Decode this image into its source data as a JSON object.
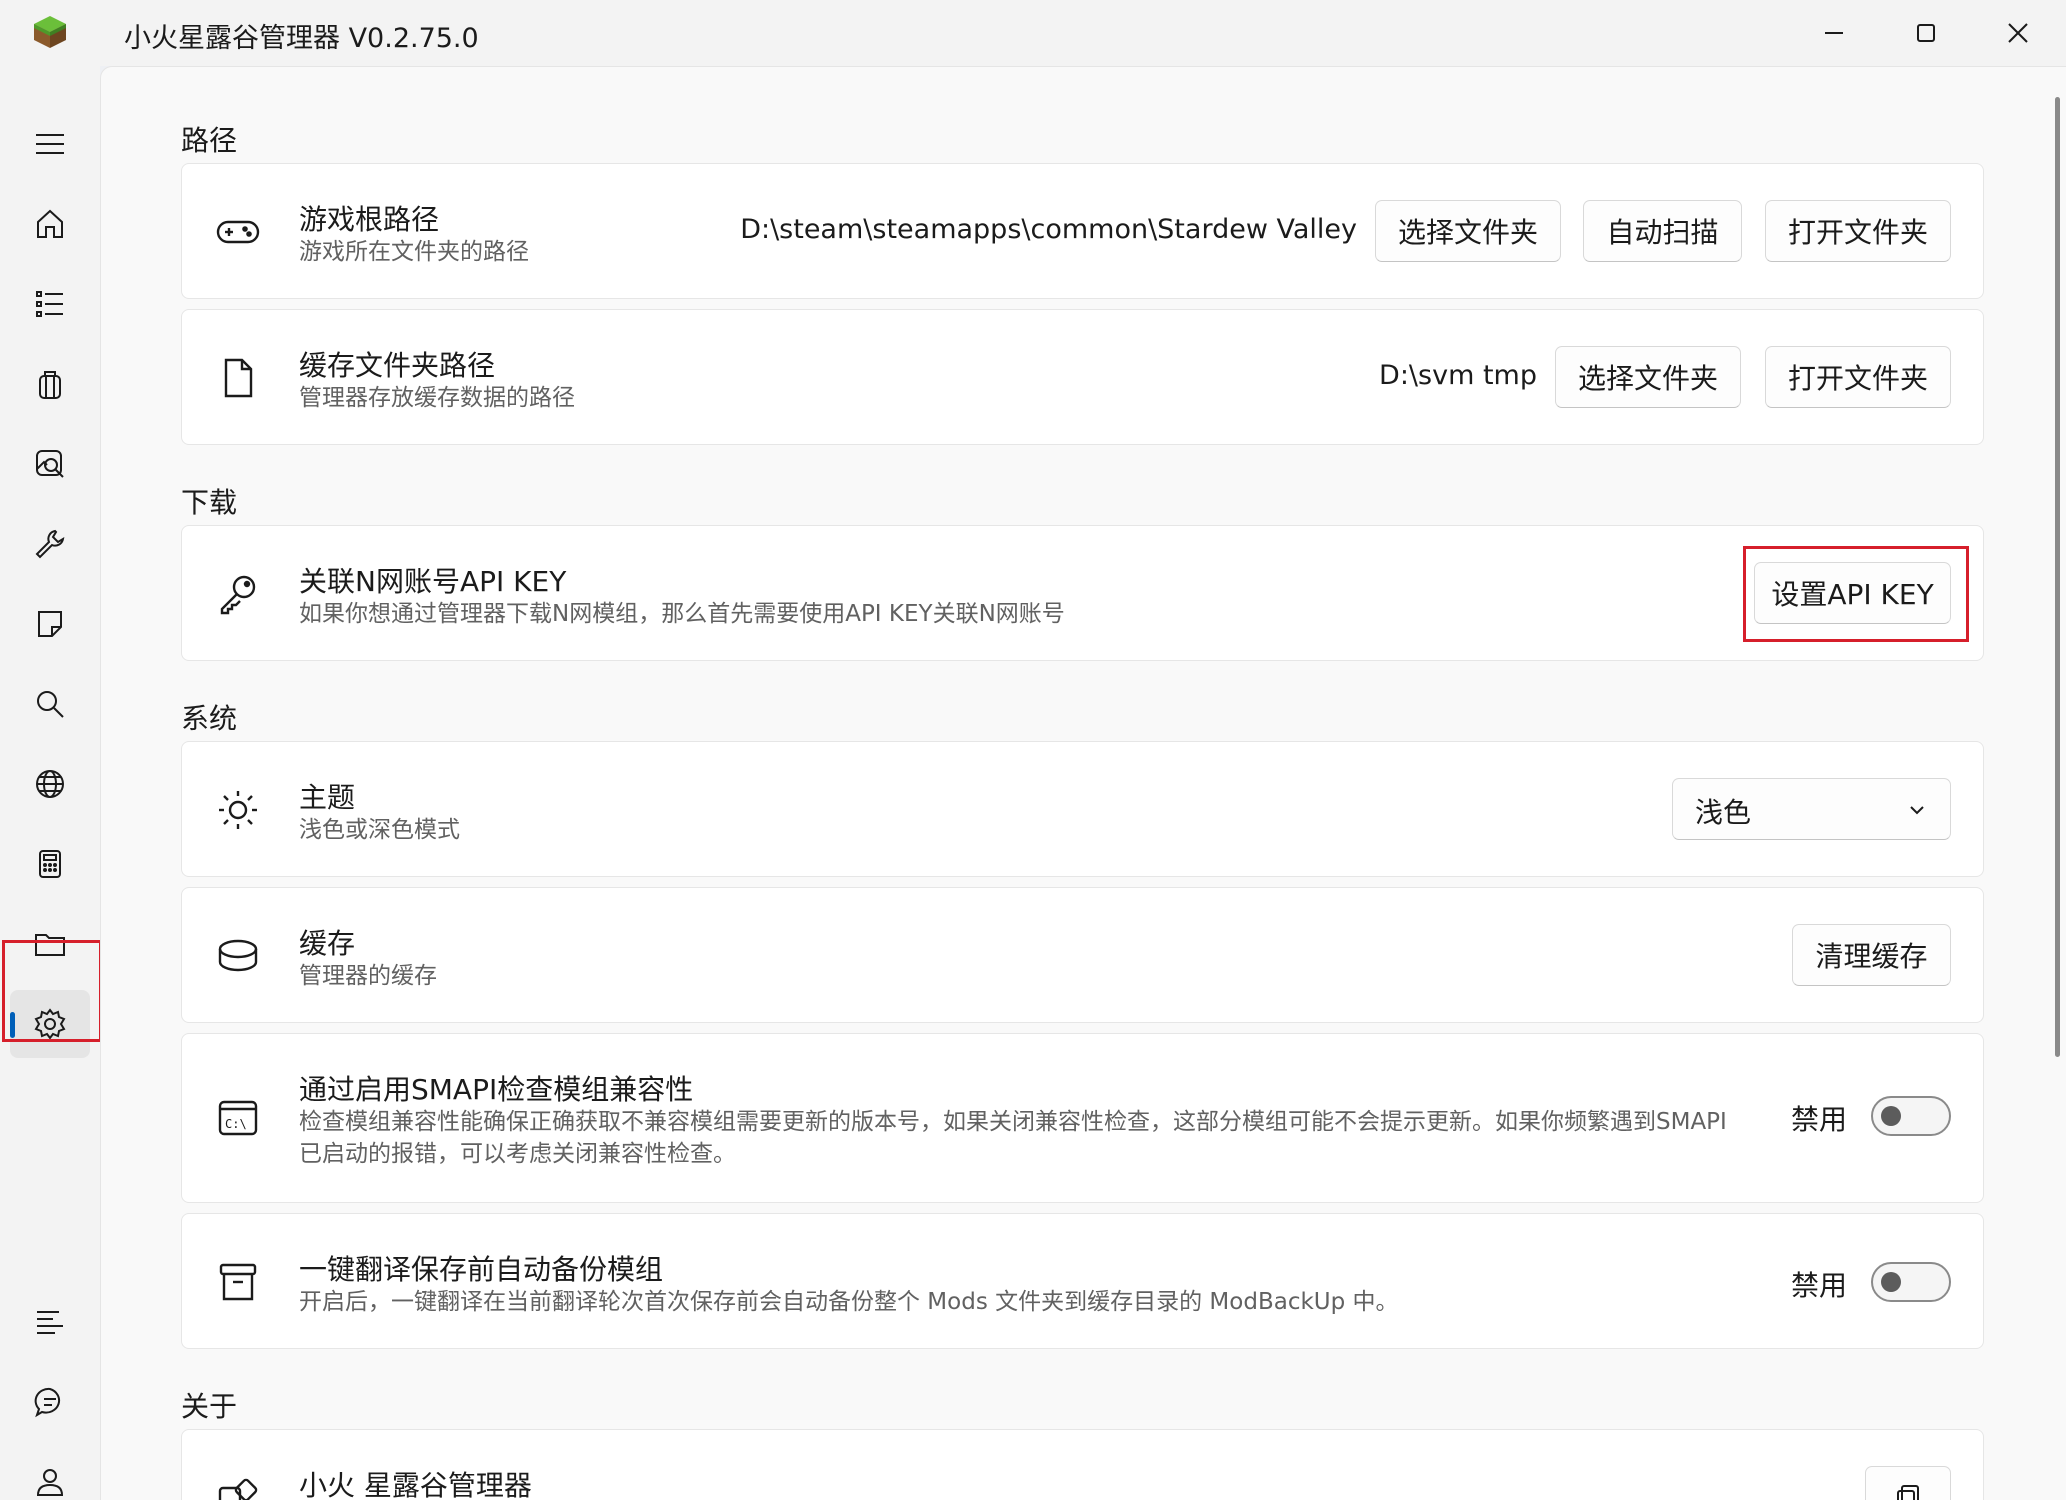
{
  "window": {
    "title": "小火星露谷管理器 V0.2.75.0"
  },
  "sidebar": {
    "items": [
      {
        "icon": "menu-icon"
      },
      {
        "icon": "home-icon"
      },
      {
        "icon": "list-icon"
      },
      {
        "icon": "backpack-icon"
      },
      {
        "icon": "image-search-icon"
      },
      {
        "icon": "wrench-icon"
      },
      {
        "icon": "note-icon"
      },
      {
        "icon": "search-icon"
      },
      {
        "icon": "globe-icon"
      },
      {
        "icon": "calculator-icon"
      },
      {
        "icon": "folder-icon"
      },
      {
        "icon": "gear-icon"
      }
    ],
    "bottom_items": [
      {
        "icon": "log-list-icon"
      },
      {
        "icon": "chat-icon"
      },
      {
        "icon": "user-icon"
      }
    ]
  },
  "sections": {
    "path": {
      "title": "路径",
      "game_root": {
        "title": "游戏根路径",
        "desc": "游戏所在文件夹的路径",
        "value": "D:\\steam\\steamapps\\common\\Stardew Valley",
        "btn_select": "选择文件夹",
        "btn_scan": "自动扫描",
        "btn_open": "打开文件夹"
      },
      "cache_folder": {
        "title": "缓存文件夹路径",
        "desc": "管理器存放缓存数据的路径",
        "value": "D:\\svm tmp",
        "btn_select": "选择文件夹",
        "btn_open": "打开文件夹"
      }
    },
    "download": {
      "title": "下载",
      "api_key": {
        "title": "关联N网账号API KEY",
        "desc": "如果你想通过管理器下载N网模组，那么首先需要使用API KEY关联N网账号",
        "btn": "设置API KEY"
      }
    },
    "system": {
      "title": "系统",
      "theme": {
        "title": "主题",
        "desc": "浅色或深色模式",
        "selected": "浅色"
      },
      "cache": {
        "title": "缓存",
        "desc": "管理器的缓存",
        "btn": "清理缓存"
      },
      "smapi": {
        "title": "通过启用SMAPI检查模组兼容性",
        "desc": "检查模组兼容性能确保正确获取不兼容模组需要更新的版本号，如果关闭兼容性检查，这部分模组可能不会提示更新。如果你频繁遇到SMAPI已启动的报错，可以考虑关闭兼容性检查。",
        "toggle_label": "禁用"
      },
      "backup": {
        "title": "一键翻译保存前自动备份模组",
        "desc": "开启后，一键翻译在当前翻译轮次首次保存前会自动备份整个 Mods 文件夹到缓存目录的 ModBackUp 中。",
        "toggle_label": "禁用"
      }
    },
    "about": {
      "title": "关于",
      "app": {
        "title": "小火 星露谷管理器"
      }
    }
  },
  "colors": {
    "accent": "#005fb8",
    "highlight": "#d61f2b"
  }
}
